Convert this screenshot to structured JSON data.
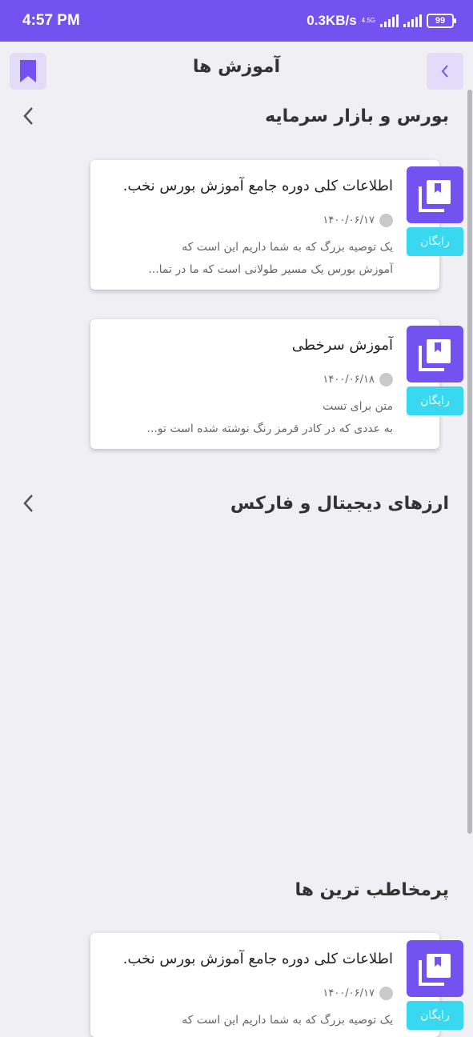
{
  "status_bar": {
    "time": "4:57 PM",
    "speed": "0.3KB/s",
    "network": "4.5G",
    "battery": "99"
  },
  "header": {
    "title": "آموزش ها",
    "bookmark_icon": "bookmark-icon",
    "back_icon": "chevron-left-icon"
  },
  "sections": [
    {
      "title": "بورس و بازار سرمایه",
      "cards": [
        {
          "title": "اطلاعات کلی دوره جامع آموزش بورس نخب.",
          "date": "۱۴۰۰/۰۶/۱۷",
          "desc_line1": "یک توصیه بزرگ که به شما داریم این است که",
          "desc_line2": "آموزش بورس یک مسیر طولانی است که ما در تما...",
          "badge": "رایگان"
        },
        {
          "title": "آموزش سرخطی",
          "date": "۱۴۰۰/۰۶/۱۸",
          "desc_line1": "متن برای تست",
          "desc_line2": "به عددی که در کادر قرمز رنگ نوشته شده است تو...",
          "badge": "رایگان"
        }
      ]
    },
    {
      "title": "ارزهای دیجیتال و فارکس",
      "cards": []
    },
    {
      "title": "پرمخاطب ترین ها",
      "cards": [
        {
          "title": "اطلاعات کلی دوره جامع آموزش بورس نخب.",
          "date": "۱۴۰۰/۰۶/۱۷",
          "desc_line1": "یک توصیه بزرگ که به شما داریم این است که",
          "badge": "رایگان"
        }
      ]
    }
  ],
  "colors": {
    "primary": "#7352f0",
    "badge": "#37d8f0",
    "background": "#efeff4"
  }
}
